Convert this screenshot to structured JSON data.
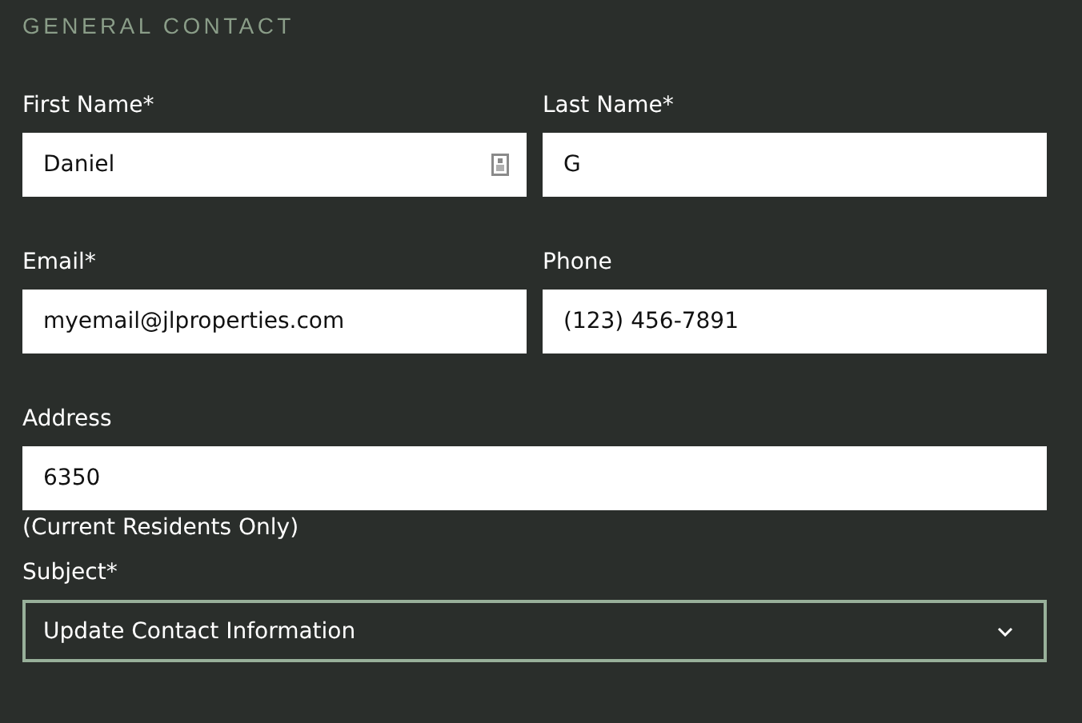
{
  "section_title": "GENERAL CONTACT",
  "rows": [
    {
      "fields": [
        {
          "kind": "text",
          "label": "First Name*",
          "value": "Daniel",
          "autofill_icon": true
        },
        {
          "kind": "text",
          "label": "Last Name*",
          "value": "G",
          "autofill_icon": false
        }
      ]
    },
    {
      "fields": [
        {
          "kind": "text",
          "label": "Email*",
          "value": "myemail@jlproperties.com",
          "autofill_icon": false
        },
        {
          "kind": "text",
          "label": "Phone",
          "value": "(123) 456-7891",
          "autofill_icon": false
        }
      ]
    },
    {
      "fields": [
        {
          "kind": "text",
          "label": "Address",
          "value": "6350",
          "hint": "(Current Residents Only)",
          "autofill_icon": false
        }
      ]
    },
    {
      "fields": [
        {
          "kind": "select",
          "label": "Subject*",
          "value": "Update Contact Information"
        }
      ]
    }
  ]
}
